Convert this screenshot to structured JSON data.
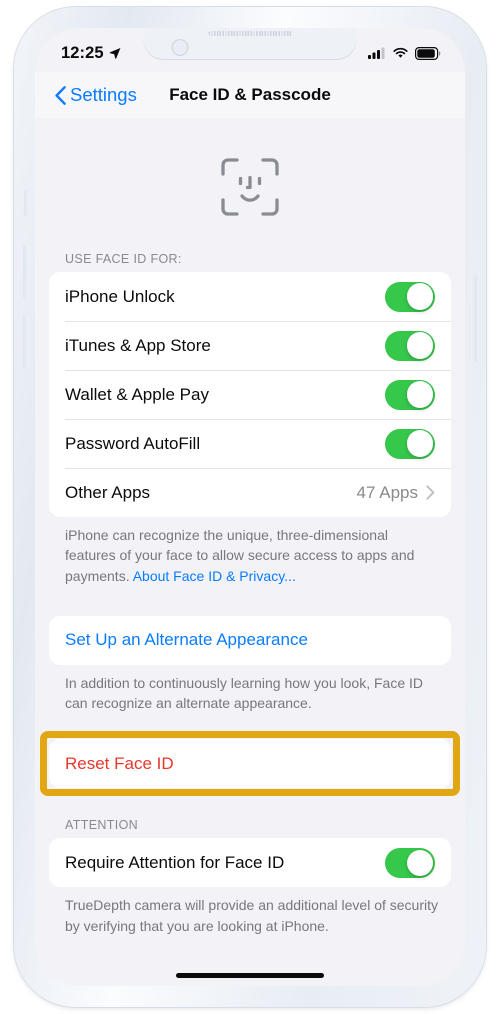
{
  "statusbar": {
    "time": "12:25",
    "location_icon": "location-arrow-icon",
    "cellular_icon": "cellular-bars-icon",
    "wifi_icon": "wifi-icon",
    "battery_icon": "battery-icon"
  },
  "navbar": {
    "back_label": "Settings",
    "back_icon": "chevron-left-icon",
    "title": "Face ID & Passcode"
  },
  "hero": {
    "icon": "face-id-icon"
  },
  "sections": {
    "use_face_id": {
      "header": "USE FACE ID FOR:",
      "rows": [
        {
          "label": "iPhone Unlock",
          "type": "toggle",
          "value": "on"
        },
        {
          "label": "iTunes & App Store",
          "type": "toggle",
          "value": "on"
        },
        {
          "label": "Wallet & Apple Pay",
          "type": "toggle",
          "value": "on"
        },
        {
          "label": "Password AutoFill",
          "type": "toggle",
          "value": "on"
        },
        {
          "label": "Other Apps",
          "type": "disclosure",
          "value": "47 Apps"
        }
      ],
      "footnote_text": "iPhone can recognize the unique, three-dimensional features of your face to allow secure access to apps and payments. ",
      "footnote_link": "About Face ID & Privacy..."
    },
    "alternate_appearance": {
      "action_label": "Set Up an Alternate Appearance",
      "footnote_text": "In addition to continuously learning how you look, Face ID can recognize an alternate appearance."
    },
    "reset": {
      "action_label": "Reset Face ID",
      "highlight_color": "#e0a712"
    },
    "attention": {
      "header": "ATTENTION",
      "rows": [
        {
          "label": "Require Attention for Face ID",
          "type": "toggle",
          "value": "on"
        }
      ],
      "footnote_text": "TrueDepth camera will provide an additional level of security by verifying that you are looking at iPhone."
    }
  },
  "colors": {
    "accent_blue": "#0a7cff",
    "toggle_green": "#36c84b",
    "destructive_red": "#e8382b",
    "highlight_gold": "#e0a712"
  }
}
